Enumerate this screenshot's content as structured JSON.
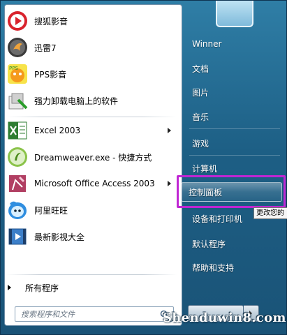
{
  "left_pane": {
    "programs": [
      {
        "label": "搜狐影音",
        "icon": "sohu-video-icon"
      },
      {
        "label": "迅雷7",
        "icon": "thunder-icon"
      },
      {
        "label": "PPS影音",
        "icon": "pps-icon"
      },
      {
        "label": "强力卸载电脑上的软件",
        "icon": "uninstall-icon"
      },
      {
        "label": "Excel 2003",
        "icon": "excel-icon",
        "submenu": true
      },
      {
        "label": "Dreamweaver.exe - 快捷方式",
        "icon": "dreamweaver-icon"
      },
      {
        "label": "Microsoft Office Access 2003",
        "icon": "access-icon",
        "submenu": true
      },
      {
        "label": "阿里旺旺",
        "icon": "aliwangwang-icon"
      },
      {
        "label": "最新影视大全",
        "icon": "video-collection-icon"
      }
    ],
    "all_programs_label": "所有程序",
    "search_placeholder": "搜索程序和文件"
  },
  "right_pane": {
    "items": [
      {
        "label": "Winner"
      },
      {
        "label": "文档"
      },
      {
        "label": "图片"
      },
      {
        "label": "音乐"
      },
      {
        "label": "游戏"
      },
      {
        "label": "计算机"
      },
      {
        "label": "控制面板"
      },
      {
        "label": "设备和打印机"
      },
      {
        "label": "默认程序"
      },
      {
        "label": "帮助和支持"
      }
    ],
    "tooltip": "更改您的"
  },
  "watermark": "Shenduwin8.com",
  "colors": {
    "highlight": "#c026d3",
    "menu_blue": "#1d5f85"
  }
}
